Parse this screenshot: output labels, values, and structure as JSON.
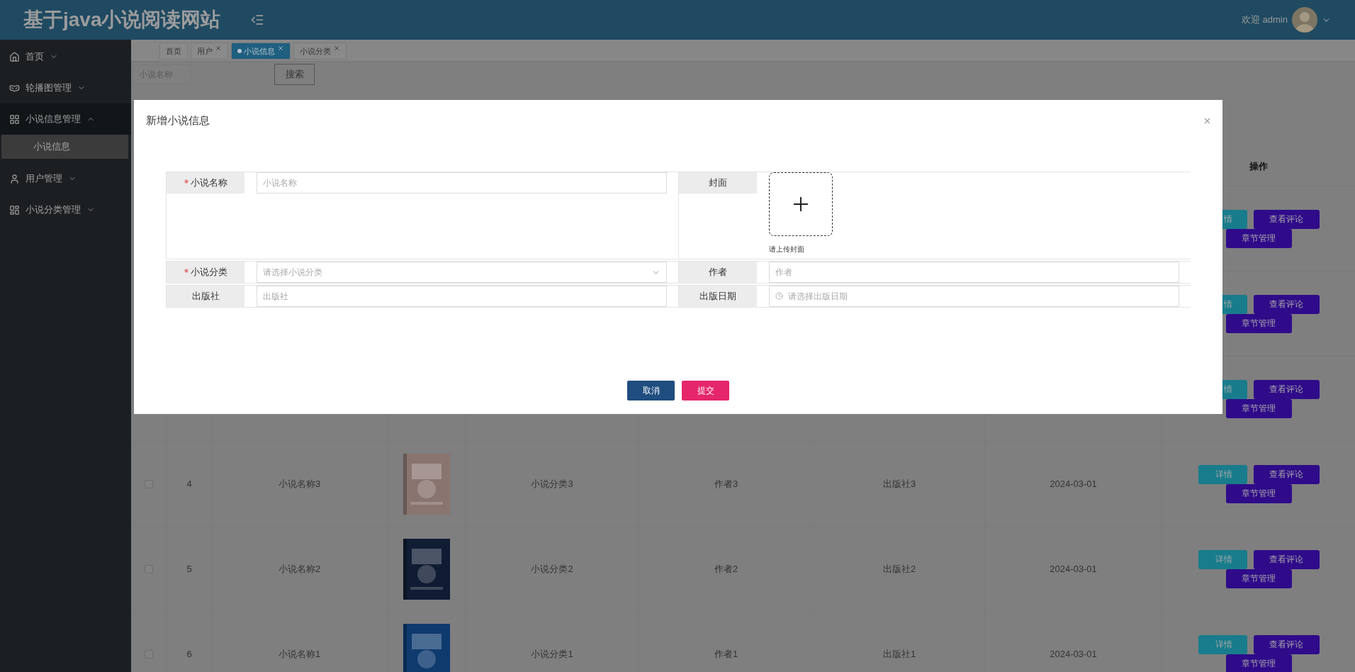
{
  "header": {
    "title": "基于java小说阅读网站",
    "welcome": "欢迎 admin"
  },
  "sidebar": {
    "items": [
      {
        "label": "首页",
        "kind": "home",
        "expanded": false
      },
      {
        "label": "轮播图管理",
        "kind": "carousel",
        "expanded": false
      },
      {
        "label": "小说信息管理",
        "kind": "novels",
        "expanded": true,
        "children": [
          {
            "label": "小说信息",
            "selected": true
          }
        ]
      },
      {
        "label": "用户管理",
        "kind": "users",
        "expanded": false
      },
      {
        "label": "小说分类管理",
        "kind": "categories",
        "expanded": false
      }
    ]
  },
  "tabs": [
    {
      "label": "首页",
      "closable": false,
      "selected": false
    },
    {
      "label": "用户",
      "closable": true,
      "selected": false
    },
    {
      "label": "小说信息",
      "closable": true,
      "selected": true
    },
    {
      "label": "小说分类",
      "closable": true,
      "selected": false
    }
  ],
  "search": {
    "placeholder": "小说名称",
    "button": "搜索"
  },
  "table": {
    "action_header": "操作",
    "rows": [
      {
        "actions": [
          {
            "kind": "detail",
            "label": "情"
          },
          {
            "kind": "comments",
            "label": "查看评论"
          },
          {
            "kind": "chapters",
            "label": "章节管理"
          }
        ]
      },
      {
        "actions": [
          {
            "kind": "detail",
            "label": "情"
          },
          {
            "kind": "comments",
            "label": "查看评论"
          },
          {
            "kind": "chapters",
            "label": "章节管理"
          }
        ]
      },
      {
        "actions": [
          {
            "kind": "detail",
            "label": "情"
          },
          {
            "kind": "comments",
            "label": "查看评论"
          },
          {
            "kind": "chapters",
            "label": "章节管理"
          }
        ]
      },
      {
        "checked": false,
        "index": "4",
        "name": "小说名称3",
        "cover": {
          "kind": "picture"
        },
        "category": "小说分类3",
        "author": "作者3",
        "publisher": "出版社3",
        "date": "2024-03-01",
        "actions": [
          {
            "kind": "detail",
            "label": "详情"
          },
          {
            "kind": "comments",
            "label": "查看评论"
          },
          {
            "kind": "chapters",
            "label": "章节管理"
          }
        ]
      },
      {
        "checked": false,
        "index": "5",
        "name": "小说名称2",
        "cover": {
          "kind": "picture"
        },
        "category": "小说分类2",
        "author": "作者2",
        "publisher": "出版社2",
        "date": "2024-03-01",
        "actions": [
          {
            "kind": "detail",
            "label": "详情"
          },
          {
            "kind": "comments",
            "label": "查看评论"
          },
          {
            "kind": "chapters",
            "label": "章节管理"
          }
        ]
      },
      {
        "checked": false,
        "index": "6",
        "name": "小说名称1",
        "cover": {
          "kind": "picture"
        },
        "category": "小说分类1",
        "author": "作者1",
        "publisher": "出版社1",
        "date": "2024-03-01",
        "actions": [
          {
            "kind": "detail",
            "label": "详情"
          },
          {
            "kind": "comments",
            "label": "查看评论"
          },
          {
            "kind": "chapters",
            "label": "章节管理"
          }
        ]
      }
    ]
  },
  "dialog": {
    "title": "新增小说信息",
    "fields": [
      {
        "kind": "text",
        "label": "小说名称",
        "required": true,
        "placeholder": "小说名称"
      },
      {
        "kind": "upload",
        "label": "封面",
        "required": false,
        "hint": "请上传封面"
      },
      {
        "kind": "select",
        "label": "小说分类",
        "required": true,
        "placeholder": "请选择小说分类"
      },
      {
        "kind": "text",
        "label": "作者",
        "required": false,
        "placeholder": "作者"
      },
      {
        "kind": "text",
        "label": "出版社",
        "required": false,
        "placeholder": "出版社"
      },
      {
        "kind": "date",
        "label": "出版日期",
        "required": false,
        "placeholder": "请选择出版日期"
      }
    ],
    "buttons": [
      {
        "kind": "cancel",
        "label": "取消"
      },
      {
        "kind": "submit",
        "label": "提交"
      }
    ]
  }
}
